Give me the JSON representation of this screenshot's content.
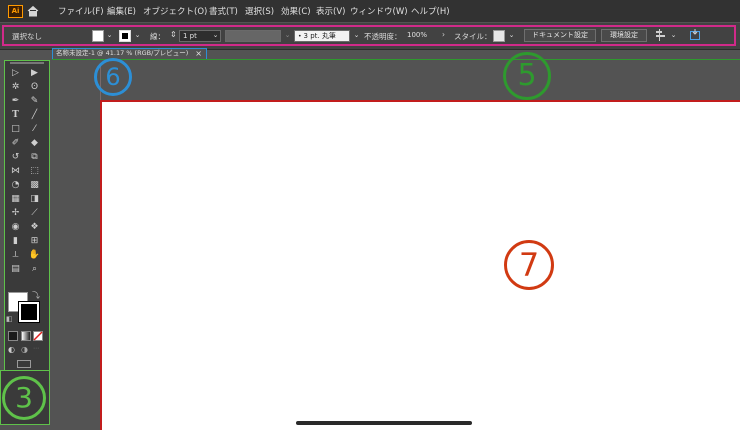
{
  "app": {
    "logo_text": "Ai",
    "logo_color": "#ff9a00"
  },
  "menu": {
    "items": [
      "ファイル(F)",
      "編集(E)",
      "オブジェクト(O)",
      "書式(T)",
      "選択(S)",
      "効果(C)",
      "表示(V)",
      "ウィンドウ(W)",
      "ヘルプ(H)"
    ]
  },
  "control_bar": {
    "selection_label": "選択なし",
    "stroke_label": "線：",
    "stroke_weight": "1 pt",
    "brush_value": "3 pt. 丸筆",
    "opacity_label": "不透明度：",
    "opacity_value": "100%",
    "style_label": "スタイル：",
    "document_setup_button": "ドキュメント設定",
    "preferences_button": "環境設定"
  },
  "document_tab": {
    "title": "名称未設定-1 @ 41.17 % (RGB/プレビュー)",
    "close_glyph": "×"
  },
  "annotations": {
    "n5": "⑤",
    "n6": "⑥",
    "n7": "⑦",
    "n3": "③",
    "colors": {
      "control_bar": "#d12a8a",
      "tab": "#2c8fd6",
      "panel": "#2e9a2e",
      "toolbar": "#5fc24a",
      "artboard": "#c21d1d"
    }
  },
  "colors": {
    "menu_bg": "#323232",
    "control_bg": "#424242",
    "workspace_bg": "#535353",
    "artboard_bg": "#ffffff"
  }
}
